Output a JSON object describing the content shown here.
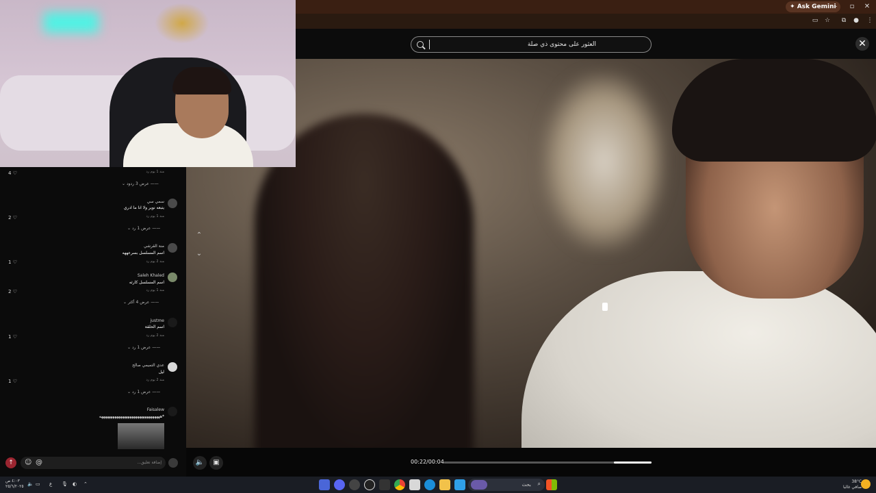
{
  "browser": {
    "gemini_label": "Ask Gemini",
    "minimize": "–",
    "maximize": "▫",
    "close": "✕"
  },
  "search": {
    "text": "العثور على محتوى ذي صلة"
  },
  "close_symbol": "✕",
  "video": {
    "time": "00:22/00:04",
    "progress": 0.18
  },
  "comments": [
    {
      "likes": "4",
      "meta": "منذ 1 يوم  رد",
      "replies": "عرض 3 ردود"
    },
    {
      "name": "سمي سي",
      "text": "يتبعه نوير ولا انا ما ادري",
      "meta": "منذ 1 يوم  رد",
      "likes": "2",
      "replies": "عرض 1 رد"
    },
    {
      "name": "منة القرشي",
      "text": "اسم المسلسل بسرعههه",
      "meta": "منذ 2 يوم  رد",
      "likes": "1"
    },
    {
      "name": "Saleh Khaled",
      "text": "اسم المسلسل كارثه",
      "meta": "منذ 1 يوم  رد",
      "likes": "2",
      "replies": "عرض 4 أكثر"
    },
    {
      "name": "justme",
      "text": "اسم الحلقة",
      "meta": "منذ 2 يوم  رد",
      "likes": "1",
      "replies": "عرض 1 رد"
    },
    {
      "name": "عدي التميمي صالح",
      "text": "ليل",
      "meta": "منذ 2 يوم  رد",
      "likes": "1",
      "replies": "عرض 1 رد"
    },
    {
      "name": "Faisalew",
      "text": "*ههههههههههههههههههههههههههههههههه"
    }
  ],
  "comment_input": {
    "placeholder": "إضافة تعليق..."
  },
  "taskbar": {
    "search_placeholder": "بحث",
    "weather": "38°C",
    "weather_desc": "صافي غالبا",
    "time": "٤:٠٣ ص",
    "date": "٢٥/٦/٢٠٢٥",
    "lang": "ع"
  }
}
